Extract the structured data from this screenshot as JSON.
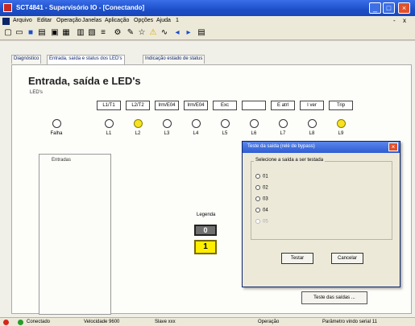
{
  "window": {
    "title": "SCT4841 - Supervisório IO - [Conectando]",
    "minimize_label": "_",
    "maximize_label": "□",
    "close_label": "×"
  },
  "menu": {
    "items": [
      "Arquivo",
      "Editar",
      "Operação",
      "Janelas",
      "Aplicação",
      "Opções",
      "Ajuda",
      "1"
    ],
    "mdi_controls": [
      "-",
      "x"
    ]
  },
  "toolbar": {
    "icons": [
      "new-icon",
      "open-icon",
      "save-icon",
      "print-icon",
      "copy-icon",
      "paste-icon",
      "chart-icon",
      "monitor-icon",
      "text-icon",
      "settings-icon",
      "tool-icon",
      "star-icon",
      "warning-icon",
      "signal-icon",
      "arrow-left-icon",
      "arrow-right-icon",
      "calc-icon"
    ]
  },
  "tabs": [
    {
      "label": "Diagnóstico"
    },
    {
      "label": "Entrada, saída e status dos LED's"
    },
    {
      "label": "Indicação estado de status"
    }
  ],
  "page_title": "Entrada, saída e LED's",
  "leds_group_label": "LED's",
  "led_headers": [
    "L1/T1",
    "L2/T2",
    "Irm/E04",
    "Irm/E04",
    "Exc",
    "",
    "E atrl",
    "I ver",
    "Trip"
  ],
  "leds": [
    {
      "label": "Falha",
      "state": "off"
    },
    {
      "label": "L1",
      "state": "off"
    },
    {
      "label": "L2",
      "state": "on"
    },
    {
      "label": "L3",
      "state": "off"
    },
    {
      "label": "L4",
      "state": "off"
    },
    {
      "label": "L5",
      "state": "off"
    },
    {
      "label": "L6",
      "state": "off"
    },
    {
      "label": "L7",
      "state": "off"
    },
    {
      "label": "L8",
      "state": "off"
    },
    {
      "label": "L9",
      "state": "on"
    }
  ],
  "entradas_label": "Entradas",
  "legenda": {
    "label": "Legenda",
    "off_value": "0",
    "on_value": "1"
  },
  "teste_button": "Teste das saídas ...",
  "dialog": {
    "title": "Teste da saída (relé de bypass)",
    "group_label": "Selecione a saída a ser testada",
    "options": [
      {
        "label": "01",
        "enabled": true
      },
      {
        "label": "02",
        "enabled": true
      },
      {
        "label": "03",
        "enabled": true
      },
      {
        "label": "04",
        "enabled": true
      },
      {
        "label": "05",
        "enabled": false
      }
    ],
    "ok_label": "Testar",
    "cancel_label": "Cancelar"
  },
  "statusbar": {
    "items": [
      "Conectado",
      "Velocidade 9600",
      "Slave xxx",
      "Operação",
      "Parâmetro vindo serial 11"
    ]
  },
  "colors": {
    "titlebar": "#1c4fc8",
    "led_on": "#f7e21f",
    "legend_off": "#707070",
    "legend_on": "#ffee00",
    "close_button": "#e0502a"
  }
}
